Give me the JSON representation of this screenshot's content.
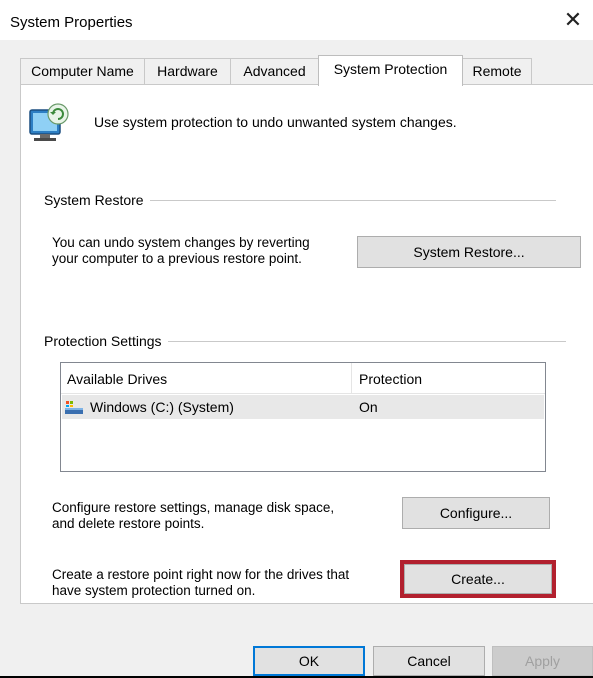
{
  "window": {
    "title": "System Properties",
    "close_glyph": "✕"
  },
  "tabs": [
    {
      "label": "Computer Name",
      "active": false
    },
    {
      "label": "Hardware",
      "active": false
    },
    {
      "label": "Advanced",
      "active": false
    },
    {
      "label": "System Protection",
      "active": true
    },
    {
      "label": "Remote",
      "active": false
    }
  ],
  "intro": {
    "icon": "system-protection-icon",
    "text": "Use system protection to undo unwanted system changes."
  },
  "system_restore": {
    "group_title": "System Restore",
    "description_line1": "You can undo system changes by reverting",
    "description_line2": "your computer to a previous restore point.",
    "button_label": "System Restore..."
  },
  "protection": {
    "group_title": "Protection Settings",
    "columns": [
      "Available Drives",
      "Protection"
    ],
    "drives": [
      {
        "icon": "drive-icon",
        "name": "Windows (C:) (System)",
        "protection": "On"
      }
    ],
    "configure_line1": "Configure restore settings, manage disk space,",
    "configure_line2": "and delete restore points.",
    "configure_label": "Configure...",
    "create_line1": "Create a restore point right now for the drives that",
    "create_line2": "have system protection turned on.",
    "create_label": "Create...",
    "highlight_color": "#b2202e"
  },
  "footer": {
    "ok_label": "OK",
    "cancel_label": "Cancel",
    "apply_label": "Apply"
  }
}
